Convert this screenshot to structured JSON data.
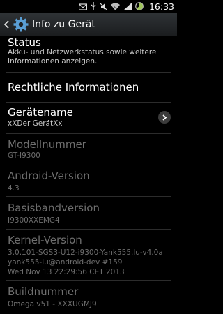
{
  "status_bar": {
    "time": "16:33",
    "icons": [
      "mail-icon",
      "usb-icon",
      "silent-icon",
      "wifi-icon",
      "signal-icon",
      "battery-icon"
    ]
  },
  "action_bar": {
    "title": "Info zu Gerät",
    "icon": "settings-gear-icon"
  },
  "items": [
    {
      "key": "status",
      "title": "Status",
      "subtitle": "Akku- und Netzwerkstatus sowie weitere\nInformationen anzeigen."
    },
    {
      "key": "legal",
      "title": "Rechtliche Informationen"
    },
    {
      "key": "device_name",
      "title": "Gerätename",
      "subtitle": "xXDer GerätXx"
    },
    {
      "key": "model",
      "title": "Modellnummer",
      "subtitle": "GT-I9300"
    },
    {
      "key": "android",
      "title": "Android-Version",
      "subtitle": "4.3"
    },
    {
      "key": "baseband",
      "title": "Basisbandversion",
      "subtitle": "I9300XXEMG4"
    },
    {
      "key": "kernel",
      "title": "Kernel-Version",
      "subtitle_lines": [
        "3.0.101-SGS3-U12-i9300-Yank555.lu-v4.0a",
        "yank555-lu@android-dev #159",
        "Wed Nov 13 22:29:56 CET 2013"
      ]
    },
    {
      "key": "build",
      "title": "Buildnummer",
      "subtitle": "Omega v51 - XXXUGMJ9"
    }
  ],
  "colors": {
    "background": "#000000",
    "disabled_text": "#6e6e6e",
    "action_bar": "#2f3336"
  }
}
